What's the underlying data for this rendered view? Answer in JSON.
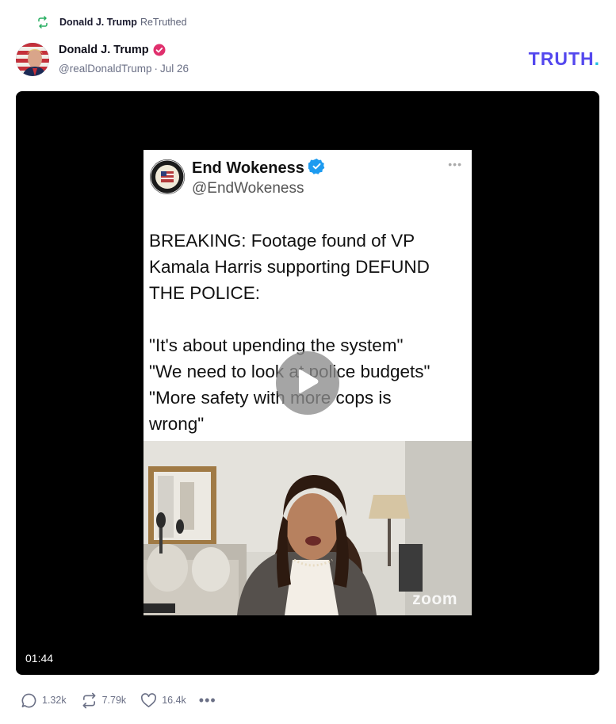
{
  "retruth": {
    "name": "Donald J. Trump",
    "verb": "ReTruthed",
    "icon": "retruth-icon"
  },
  "author": {
    "name": "Donald J. Trump",
    "handle": "@realDonaldTrump",
    "separator": "·",
    "date": "Jul 26",
    "verified_icon": "verified-badge-icon",
    "avatar_icon": "avatar-flag-portrait"
  },
  "brand": {
    "logo_text": "TRUTH",
    "logo_dot": "."
  },
  "video": {
    "duration": "01:44",
    "play_icon": "play-icon",
    "embedded_post": {
      "name": "End Wokeness",
      "handle": "@EndWokeness",
      "more": "•••",
      "verified_icon": "verified-check-icon",
      "lines": [
        "BREAKING: Footage found of VP",
        "Kamala Harris supporting DEFUND",
        "THE POLICE:",
        "",
        "\"It's about upending the system\"",
        "\"We need to look at police budgets\"",
        "\"More safety with more cops is",
        "wrong\""
      ],
      "watermark": "zoom"
    }
  },
  "actions": {
    "replies": {
      "icon": "reply-icon",
      "count": "1.32k"
    },
    "retruths": {
      "icon": "retruth-icon",
      "count": "7.79k"
    },
    "likes": {
      "icon": "heart-icon",
      "count": "16.4k"
    },
    "more_label": "•••"
  },
  "colors": {
    "brand": "#5448ee",
    "verified": "#e0306d",
    "meta": "#6b7086",
    "retruth_green": "#27ae60"
  }
}
